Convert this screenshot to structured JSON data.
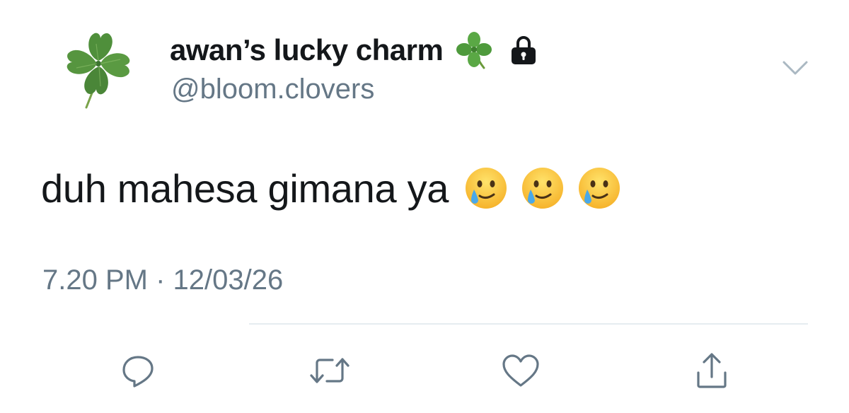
{
  "tweet": {
    "display_name": "awan’s lucky charm",
    "handle": "@bloom.clovers",
    "text": "duh mahesa gimana ya",
    "timestamp": "7.20 PM · 12/03/26"
  },
  "icons": {
    "avatar": "four-leaf-clover",
    "name_emoji": "four-leaf-clover-emoji",
    "protected": "lock-icon",
    "menu": "chevron-down-icon",
    "text_emojis": [
      "smiling-face-with-tear",
      "smiling-face-with-tear",
      "smiling-face-with-tear"
    ],
    "actions": [
      "reply-icon",
      "retweet-icon",
      "like-icon",
      "share-icon"
    ]
  },
  "colors": {
    "text_primary": "#14171a",
    "text_secondary": "#657786",
    "divider": "#e6ecf0",
    "clover_green": "#4f8f3b"
  }
}
